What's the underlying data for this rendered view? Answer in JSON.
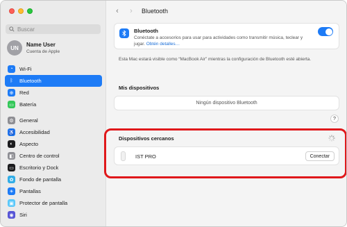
{
  "sidebar": {
    "search_placeholder": "Buscar",
    "account": {
      "initials": "UN",
      "name": "Name User",
      "subtitle": "Cuenta de Apple"
    },
    "group1": [
      {
        "label": "Wi-Fi",
        "icon": "wifi-icon",
        "color": "#1d7bf6",
        "glyph": "◔"
      },
      {
        "label": "Bluetooth",
        "icon": "bluetooth-icon",
        "color": "#1d7bf6",
        "glyph": "ᛒ"
      },
      {
        "label": "Red",
        "icon": "globe-icon",
        "color": "#1d7bf6",
        "glyph": "⊕"
      },
      {
        "label": "Batería",
        "icon": "battery-icon",
        "color": "#34c759",
        "glyph": "▭"
      }
    ],
    "group2": [
      {
        "label": "General",
        "icon": "gear-icon",
        "color": "#8e8e93",
        "glyph": "⚙"
      },
      {
        "label": "Accesibilidad",
        "icon": "accessibility-icon",
        "color": "#1d7bf6",
        "glyph": "♿"
      },
      {
        "label": "Aspecto",
        "icon": "appearance-icon",
        "color": "#1c1c1e",
        "glyph": "◐"
      },
      {
        "label": "Centro de control",
        "icon": "control-center-icon",
        "color": "#8e8e93",
        "glyph": "◧"
      },
      {
        "label": "Escritorio y Dock",
        "icon": "desktop-dock-icon",
        "color": "#1c1c1e",
        "glyph": "▭"
      },
      {
        "label": "Fondo de pantalla",
        "icon": "wallpaper-icon",
        "color": "#32ade6",
        "glyph": "✿"
      },
      {
        "label": "Pantallas",
        "icon": "displays-icon",
        "color": "#1d7bf6",
        "glyph": "☀"
      },
      {
        "label": "Protector de pantalla",
        "icon": "screensaver-icon",
        "color": "#5ac8fa",
        "glyph": "▣"
      },
      {
        "label": "Siri",
        "icon": "siri-icon",
        "color": "#5856d6",
        "glyph": "◉"
      }
    ],
    "selected": "Bluetooth"
  },
  "main": {
    "title": "Bluetooth",
    "bluetooth": {
      "title": "Bluetooth",
      "description": "Conéctate a accesorios para usar para actividades como transmitir música, teclear y jugar.",
      "link": "Obtén detalles…",
      "enabled": true
    },
    "visible_note": "Esta Mac estará visible como “MacBook Air” mientras la configuración de Bluetooth esté abierta.",
    "my_devices": {
      "title": "Mis dispositivos",
      "empty": "Ningún dispositivo Bluetooth"
    },
    "help": "?",
    "nearby": {
      "title": "Dispositivos cercanos",
      "devices": [
        {
          "name": "IST PRO",
          "action": "Conectar"
        }
      ]
    }
  },
  "colors": {
    "accent": "#1d7bf6",
    "highlight": "#e0181b"
  }
}
